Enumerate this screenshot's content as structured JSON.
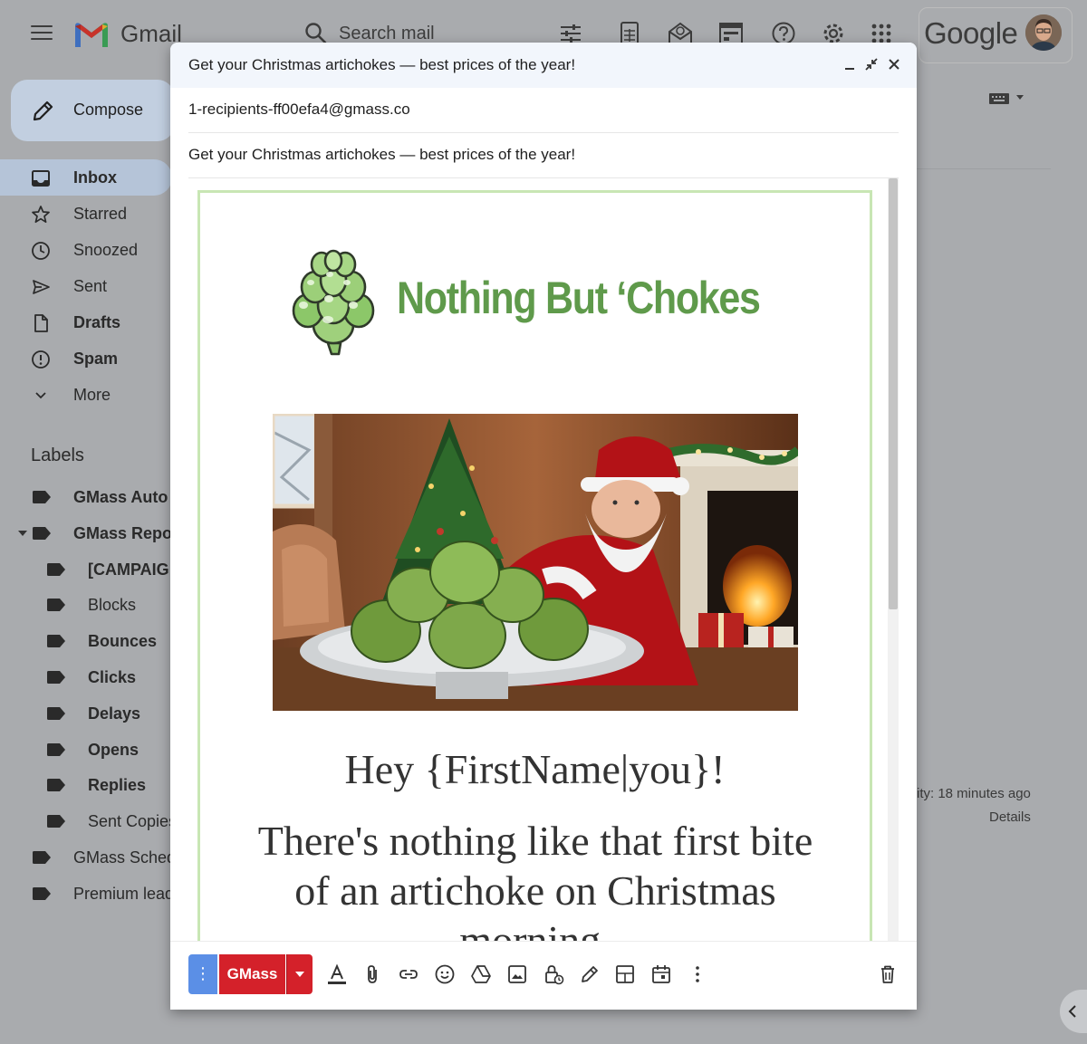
{
  "app": {
    "name": "Gmail",
    "brand": "Google",
    "search_placeholder": "Search mail"
  },
  "sidebar": {
    "compose_label": "Compose",
    "items": [
      {
        "label": "Inbox",
        "icon": "inbox-icon",
        "bold": true,
        "active": true
      },
      {
        "label": "Starred",
        "icon": "star-icon",
        "bold": false
      },
      {
        "label": "Snoozed",
        "icon": "clock-icon",
        "bold": false
      },
      {
        "label": "Sent",
        "icon": "send-icon",
        "bold": false
      },
      {
        "label": "Drafts",
        "icon": "draft-icon",
        "bold": true
      },
      {
        "label": "Spam",
        "icon": "spam-icon",
        "bold": true
      },
      {
        "label": "More",
        "icon": "chevron-down-icon",
        "bold": false
      }
    ],
    "labels_title": "Labels",
    "labels": [
      {
        "label": "GMass Auto",
        "bold": true,
        "indent": 0
      },
      {
        "label": "GMass Repo",
        "bold": true,
        "indent": 0
      },
      {
        "label": "[CAMPAIG",
        "bold": true,
        "indent": 1
      },
      {
        "label": "Blocks",
        "bold": false,
        "indent": 1
      },
      {
        "label": "Bounces",
        "bold": true,
        "indent": 1
      },
      {
        "label": "Clicks",
        "bold": true,
        "indent": 1
      },
      {
        "label": "Delays",
        "bold": true,
        "indent": 1
      },
      {
        "label": "Opens",
        "bold": true,
        "indent": 1
      },
      {
        "label": "Replies",
        "bold": true,
        "indent": 1
      },
      {
        "label": "Sent Copies",
        "bold": false,
        "indent": 1
      },
      {
        "label": "GMass Sched",
        "bold": false,
        "indent": 0
      },
      {
        "label": "Premium lead",
        "bold": false,
        "indent": 0
      }
    ]
  },
  "background": {
    "activity_text": "ity: 18 minutes ago",
    "details_link": "Details"
  },
  "compose": {
    "window_title": "Get your Christmas artichokes — best prices of the year!",
    "recipient": "1-recipients-ff00efa4@gmass.co",
    "subject": "Get your Christmas artichokes — best prices of the year!",
    "email": {
      "brand_name": "Nothing But ‘Chokes",
      "greeting": "Hey {FirstName|you}!",
      "body": "There's nothing like that first bite of an artichoke on Christmas morning."
    },
    "toolbar": {
      "options_label": "⋮",
      "send_label": "GMass"
    }
  },
  "colors": {
    "brand_green": "#5f9a4b",
    "gmass_red": "#d4212a",
    "options_blue": "#5b8fe6",
    "card_border": "#c8e6b4"
  }
}
